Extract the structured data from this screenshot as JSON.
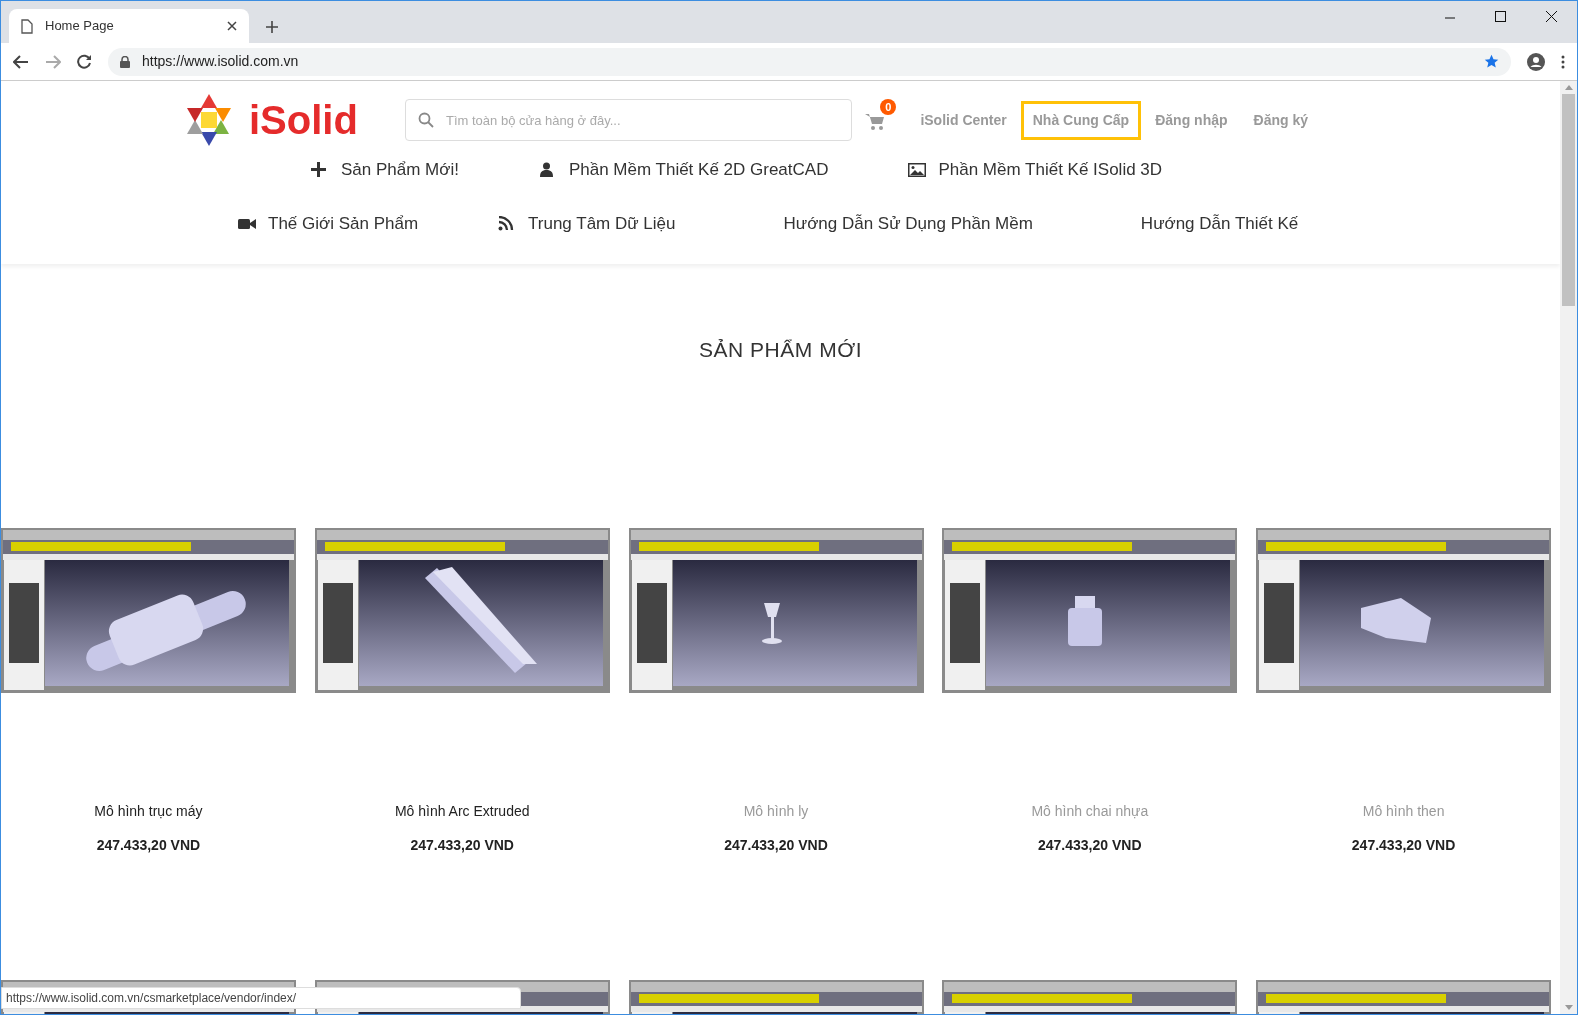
{
  "browser": {
    "tab_title": "Home Page",
    "url": "https://www.isolid.com.vn",
    "status_url": "https://www.isolid.com.vn/csmarketplace/vendor/index/"
  },
  "header": {
    "logo_text": "iSolid",
    "search": {
      "placeholder": "Tìm toàn bộ cửa hàng ở đây..."
    },
    "cart_count": "0",
    "links": [
      {
        "label": "iSolid Center",
        "selected": false
      },
      {
        "label": "Nhà Cung Cấp",
        "selected": true
      },
      {
        "label": "Đăng nhập",
        "selected": false
      },
      {
        "label": "Đăng ký",
        "selected": false
      }
    ]
  },
  "nav_rows": [
    [
      {
        "label": "Sản Phẩm Mới!"
      },
      {
        "label": "Phần Mềm Thiết Kế 2D GreatCAD"
      },
      {
        "label": "Phần Mềm Thiết Kế ISolid 3D"
      }
    ],
    [
      {
        "label": "Thế Giới Sản Phẩm"
      },
      {
        "label": "Trung Tâm Dữ Liệu"
      },
      {
        "label": "Hướng Dẫn Sử Dụng Phần Mềm"
      },
      {
        "label": "Hướng Dẫn Thiết Kế"
      }
    ]
  ],
  "section_title": "SẢN PHẨM MỚI",
  "products": [
    {
      "name": "Mô hình trục máy",
      "price": "247.433,20 VND",
      "dimmed": false
    },
    {
      "name": "Mô hình Arc Extruded",
      "price": "247.433,20 VND",
      "dimmed": false
    },
    {
      "name": "Mô hình ly",
      "price": "247.433,20 VND",
      "dimmed": true
    },
    {
      "name": "Mô hình chai nhựa",
      "price": "247.433,20 VND",
      "dimmed": true
    },
    {
      "name": "Mô hình then",
      "price": "247.433,20 VND",
      "dimmed": true
    }
  ],
  "second_row": [
    {
      "kind": "picture"
    },
    {
      "kind": "picture"
    },
    {
      "kind": "picture"
    },
    {
      "kind": "picture"
    },
    {
      "kind": "picture"
    }
  ]
}
